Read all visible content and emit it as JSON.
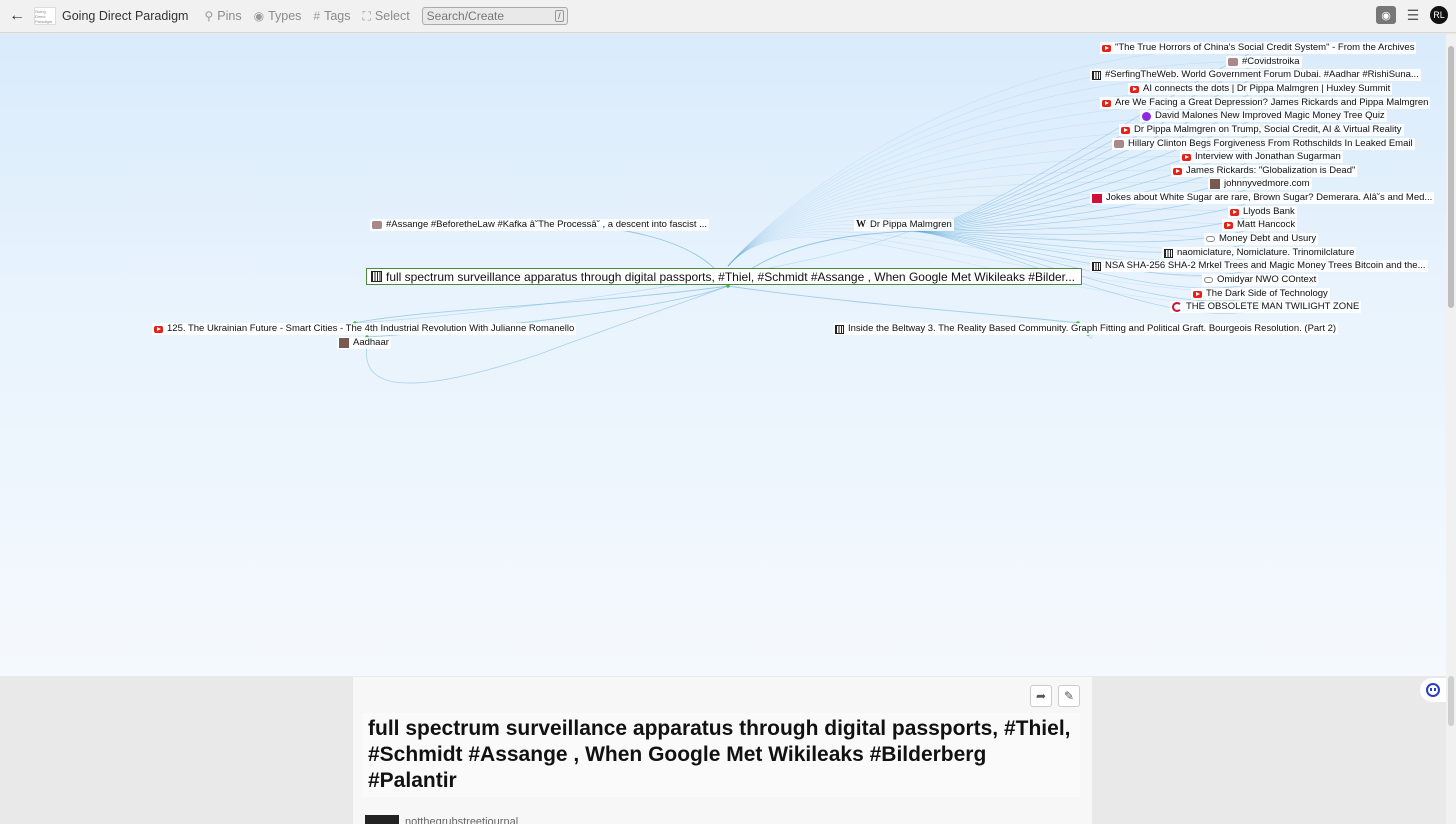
{
  "topbar": {
    "space_title": "Going Direct Paradigm",
    "logo_text": "Going Direct Paradigm",
    "tools": [
      {
        "icon": "pin-icon",
        "label": "Pins"
      },
      {
        "icon": "types-icon",
        "label": "Types"
      },
      {
        "icon": "hash-icon",
        "label": "Tags"
      },
      {
        "icon": "select-icon",
        "label": "Select"
      }
    ],
    "search_placeholder": "Search/Create",
    "search_shortcut": "/",
    "avatar_initials": "RL"
  },
  "graph": {
    "focused_node": "full spectrum surveillance apparatus through digital passports, #Thiel, #Schmidt #Assange , When Google Met Wikileaks #Bilder...",
    "nodes_right": [
      {
        "icon": "yt",
        "label": "\"The True Horrors of China's Social Credit System\" - From the Archives"
      },
      {
        "icon": "generic",
        "label": "#Covidstroika"
      },
      {
        "icon": "bank",
        "label": "#SerfingTheWeb. World Government Forum Dubai. #Aadhar #RishiSuna..."
      },
      {
        "icon": "yt",
        "label": "AI connects the dots | Dr Pippa Malmgren | Huxley Summit"
      },
      {
        "icon": "yt",
        "label": "Are We Facing a Great Depression? James Rickards and Pippa Malmgren"
      },
      {
        "icon": "circle",
        "label": "David Malones New Improved Magic Money Tree Quiz"
      },
      {
        "icon": "yt",
        "label": "Dr Pippa Malmgren on Trump, Social Credit, AI & Virtual Reality"
      },
      {
        "icon": "generic",
        "label": "Hillary Clinton Begs Forgiveness From Rothschilds In Leaked Email"
      },
      {
        "icon": "yt",
        "label": "Interview with Jonathan Sugarman"
      },
      {
        "icon": "yt",
        "label": "James Rickards: \"Globalization is Dead\""
      },
      {
        "icon": "face",
        "label": "johnnyvedmore.com"
      },
      {
        "icon": "red",
        "label": "Jokes about White Sugar are rare, Brown Sugar? Demerara. Alâ˘s and Med..."
      },
      {
        "icon": "yt",
        "label": "Llyods Bank"
      },
      {
        "icon": "yt",
        "label": "Matt Hancock"
      },
      {
        "icon": "pill",
        "label": "Money Debt and Usury"
      },
      {
        "icon": "bank",
        "label": "naomiclature, Nomiclature. Trinomilclature"
      },
      {
        "icon": "bank",
        "label": "NSA SHA-256 SHA-2 Mrkel Trees and Magic Money Trees Bitcoin and the..."
      },
      {
        "icon": "pill",
        "label": "Omidyar NWO COntext"
      },
      {
        "icon": "yt",
        "label": "The Dark Side of Technology"
      },
      {
        "icon": "spin",
        "label": "THE OBSOLETE MAN TWILIGHT ZONE"
      }
    ],
    "node_assange": "#Assange #BeforetheLaw #Kafka â˘The Processâ˘   , a descent into fascist ...",
    "node_pippa": "Dr Pippa Malmgren",
    "node_pippa_icon": "W",
    "node_ukraine": "125. The Ukrainian Future - Smart Cities - The 4th Industrial Revolution With Julianne Romanello",
    "node_aadhaar": "Aadhaar",
    "node_beltway": "Inside the Beltway 3. The Reality Based Community. Graph Fitting and Political Graft. Bourgeois Resolution. (Part 2)",
    "edge_color": "#5aa9d6"
  },
  "detail": {
    "title": "full spectrum surveillance apparatus through digital passports, #Thiel, #Schmidt #Assange , When Google Met Wikileaks #Bilderberg #Palantir",
    "author": "notthegrubstreetjournal"
  }
}
